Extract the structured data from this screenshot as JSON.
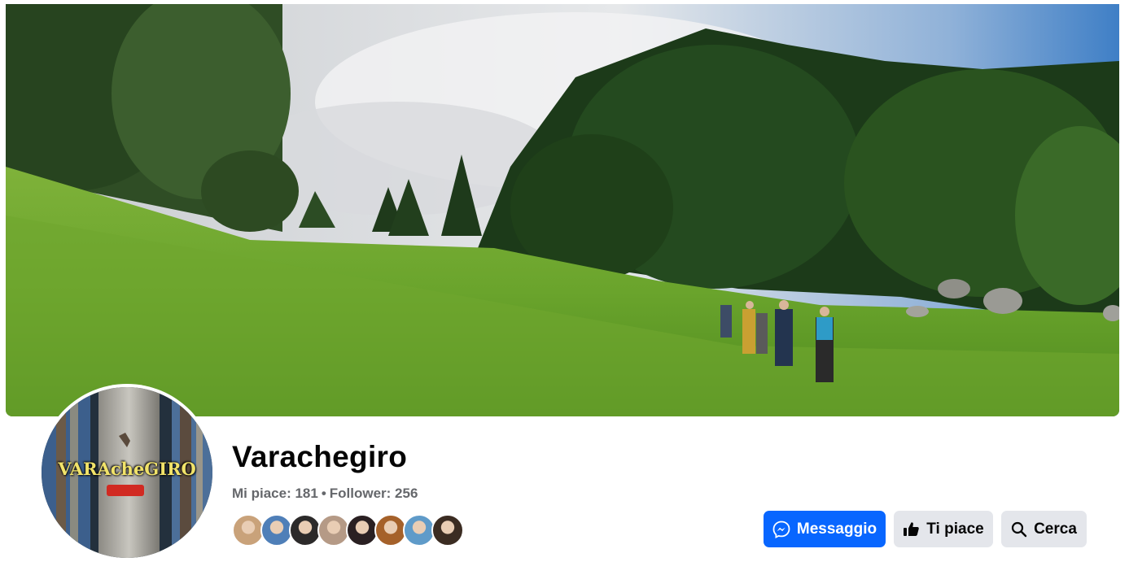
{
  "page": {
    "name": "Varachegiro",
    "likes_label": "Mi piace: 181",
    "separator": "•",
    "followers_label": "Follower: 256"
  },
  "profile_picture": {
    "overlay_text": "VARAcheGIRO"
  },
  "friends": {
    "count_visible": 8,
    "avatar_colors": [
      "#c9a27a",
      "#4f7fb8",
      "#2c2a2a",
      "#b59a86",
      "#2a2022",
      "#a5612a",
      "#5f9bc9",
      "#3b2c22"
    ]
  },
  "actions": {
    "message_label": "Messaggio",
    "like_label": "Ti piace",
    "search_label": "Cerca"
  },
  "colors": {
    "primary": "#0866ff",
    "secondary": "#e4e6eb",
    "text": "#050505",
    "muted": "#65676b"
  }
}
